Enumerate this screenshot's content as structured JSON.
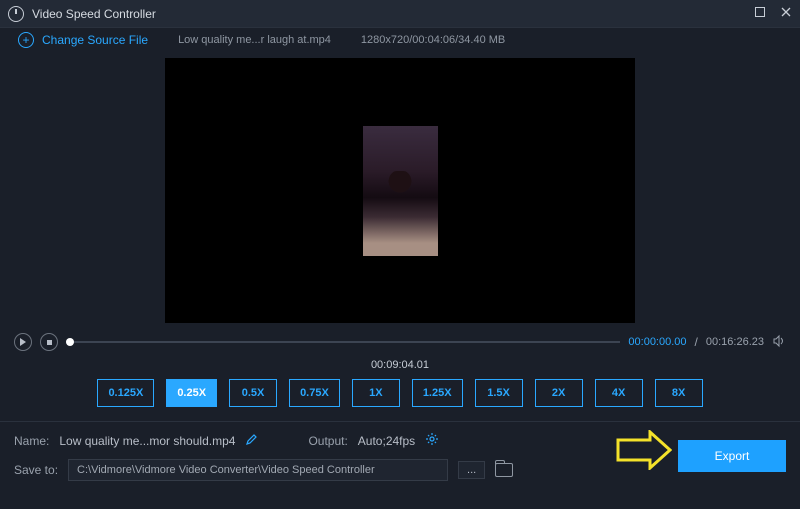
{
  "app": {
    "title": "Video Speed Controller"
  },
  "source": {
    "change_label": "Change Source File",
    "filename": "Low quality me...r laugh at.mp4",
    "meta": "1280x720/00:04:06/34.40 MB"
  },
  "playback": {
    "current_time": "00:00:00.00",
    "total_time": "00:16:26.23",
    "timeline_value": "00:09:04.01"
  },
  "speeds": {
    "options": [
      "0.125X",
      "0.25X",
      "0.5X",
      "0.75X",
      "1X",
      "1.25X",
      "1.5X",
      "2X",
      "4X",
      "8X"
    ],
    "selected": "0.25X"
  },
  "footer": {
    "name_label": "Name:",
    "name_value": "Low quality me...mor should.mp4",
    "output_label": "Output:",
    "output_value": "Auto;24fps",
    "save_label": "Save to:",
    "save_path": "C:\\Vidmore\\Vidmore Video Converter\\Video Speed Controller",
    "export_label": "Export",
    "browse_label": "..."
  },
  "colors": {
    "accent": "#2aa8ff"
  }
}
